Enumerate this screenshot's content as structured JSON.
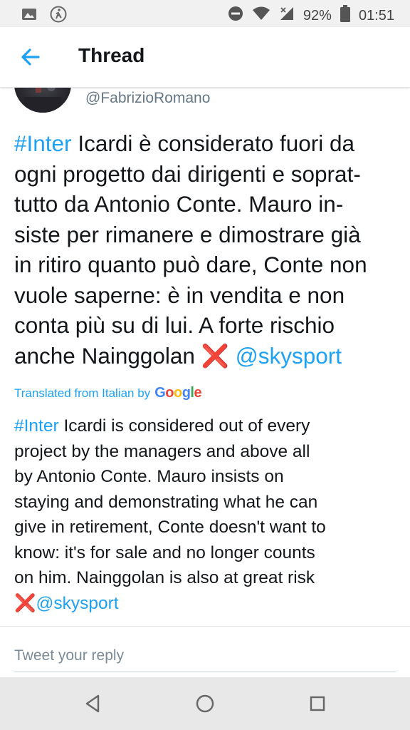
{
  "status_bar": {
    "battery": "92%",
    "time": "01:51",
    "icons": [
      "image-icon",
      "runner-icon",
      "do-not-disturb-icon",
      "wifi-icon",
      "signal-icon",
      "battery-icon"
    ]
  },
  "header": {
    "title": "Thread",
    "back_icon": "arrow-left-icon"
  },
  "tweet": {
    "handle": "@FabrizioRomano",
    "lines": [
      {
        "hashtag": "#Inter",
        "text": " Icardi è considerato fuori da"
      },
      {
        "text": "ogni progetto dai dirigenti e soprat-"
      },
      {
        "text": "tutto da Antonio Conte. Mauro in-"
      },
      {
        "text": "siste per rimanere e dimostrare già"
      },
      {
        "text": "in ritiro quanto può dare, Conte non"
      },
      {
        "text": "vuole saperne: è in vendita e non"
      },
      {
        "text": "conta più su di lui. A forte rischio"
      },
      {
        "text": "anche Nainggolan ",
        "emoji": "❌",
        "mention": "@skysport"
      }
    ]
  },
  "translation": {
    "label": "Translated from Italian by",
    "provider": "Google",
    "lines": [
      {
        "hashtag": "#Inter",
        "text": " Icardi is considered out of every"
      },
      {
        "text": "project by the managers and above all"
      },
      {
        "text": "by Antonio Conte. Mauro insists on"
      },
      {
        "text": "staying and demonstrating what he can"
      },
      {
        "text": "give in retirement, Conte doesn't want to"
      },
      {
        "text": "know: it's for sale and no longer counts"
      },
      {
        "text": "on him. Nainggolan is also at great risk"
      },
      {
        "emoji": "❌",
        "mention": "@skysport"
      }
    ]
  },
  "reply": {
    "placeholder": "Tweet your reply"
  },
  "nav_bar": {
    "icons": [
      "back-triangle-icon",
      "home-circle-icon",
      "recents-square-icon"
    ]
  },
  "colors": {
    "accent": "#1da1f2",
    "text": "#14171a",
    "secondary": "#657786",
    "emoji_red": "#d0021b"
  }
}
